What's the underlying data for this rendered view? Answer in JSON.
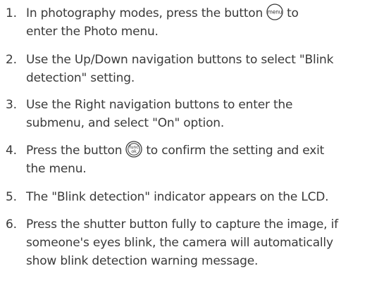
{
  "steps": [
    {
      "number": "1.",
      "line1_before": "In photography modes, press the button",
      "icon": "menu-button-icon",
      "icon_label": "menu",
      "line1_after": "to",
      "line2": "enter the Photo menu."
    },
    {
      "number": "2.",
      "line1": "Use the Up/Down navigation buttons to select \"Blink",
      "line2": "detection\" setting."
    },
    {
      "number": "3.",
      "line1": "Use the Right navigation buttons to enter the",
      "line2": "submenu, and select \"On\" option."
    },
    {
      "number": "4.",
      "line1_before": "Press the button",
      "icon": "func-ok-button-icon",
      "icon_label_top": "func",
      "icon_label_bottom": "ok",
      "line1_after": "to confirm the setting and exit",
      "line2": "the menu."
    },
    {
      "number": "5.",
      "line1": "The \"Blink detection\" indicator appears on the LCD."
    },
    {
      "number": "6.",
      "line1": "Press the shutter button fully to capture the image, if",
      "line2": "someone's eyes blink, the camera will automatically",
      "line3": "show blink detection warning message."
    }
  ],
  "colors": {
    "text": "#3a3a3a",
    "background": "#ffffff"
  }
}
